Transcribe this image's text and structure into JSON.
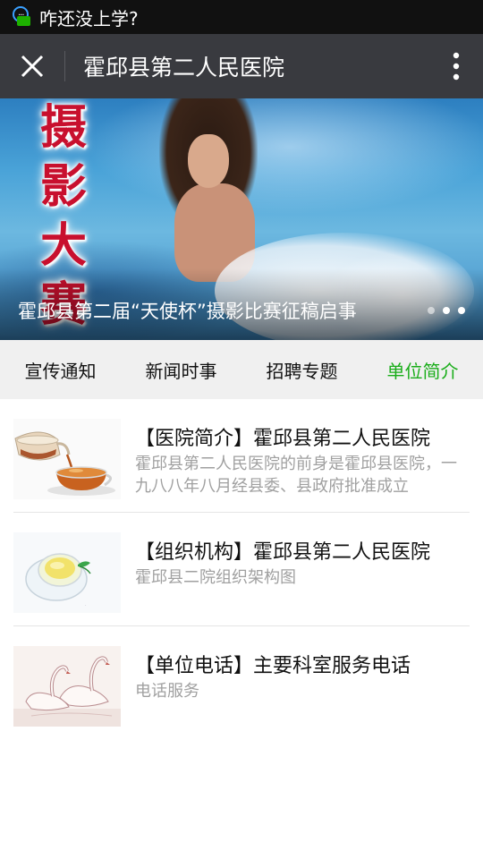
{
  "status_bar": {
    "notification_text": "咋还没上学?"
  },
  "nav": {
    "title": "霍邱县第二人民医院",
    "close_icon": "close-icon",
    "more_icon": "more-vertical-icon"
  },
  "banner": {
    "big_chars": [
      "摄",
      "影",
      "大",
      "赛"
    ],
    "caption": "霍邱县第二届“天使杯”摄影比赛征稿启事",
    "dots": 3,
    "active_dot": 0
  },
  "tabs": [
    {
      "label": "宣传通知",
      "active": false
    },
    {
      "label": "新闻时事",
      "active": false
    },
    {
      "label": "招聘专题",
      "active": false
    },
    {
      "label": "单位简介",
      "active": true
    }
  ],
  "colors": {
    "accent_green": "#19ad19",
    "nav_bg": "#393a3f",
    "status_bg": "#111111"
  },
  "list": [
    {
      "title": "【医院简介】霍邱县第二人民医院",
      "desc": "霍邱县第二人民医院的前身是霍邱县医院，一九八八年八月经县委、县政府批准成立",
      "thumb": "tea-pot-image"
    },
    {
      "title": "【组织机构】霍邱县第二人民医院",
      "desc": "霍邱县二院组织架构图",
      "thumb": "tea-cup-image"
    },
    {
      "title": "【单位电话】主要科室服务电话",
      "desc": "电话服务",
      "thumb": "swan-image"
    }
  ]
}
